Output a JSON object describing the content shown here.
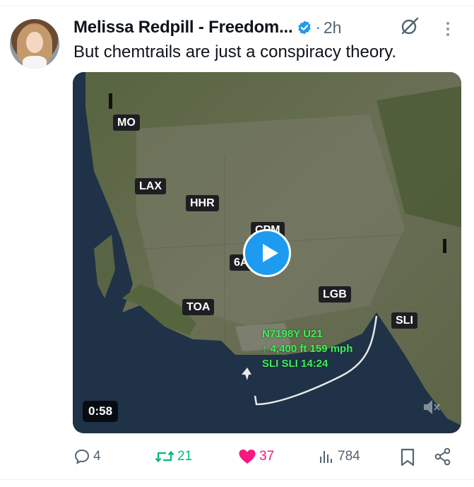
{
  "post": {
    "author_name": "Melissa Redpill - Freedom...",
    "time_separator": "·",
    "time": "2h",
    "text": "But chemtrails are just a conspiracy theory."
  },
  "video": {
    "duration": "0:58",
    "map_labels": {
      "mo": "MO",
      "lax": "LAX",
      "hhr": "HHR",
      "cpm": "CPM",
      "six_a": "6A",
      "toa": "TOA",
      "lgb": "LGB",
      "sli": "SLI"
    },
    "flight_info": {
      "line1": "N7198Y U21",
      "line2": "↑ 4,400 ft 159 mph",
      "line3": "SLI SLI 14:24"
    }
  },
  "actions": {
    "replies": "4",
    "reposts": "21",
    "likes": "37",
    "views": "784"
  },
  "colors": {
    "repost_green": "#00ba7c",
    "like_pink": "#f91880",
    "icon_gray": "#536471",
    "verified_blue": "#1d9bf0"
  }
}
